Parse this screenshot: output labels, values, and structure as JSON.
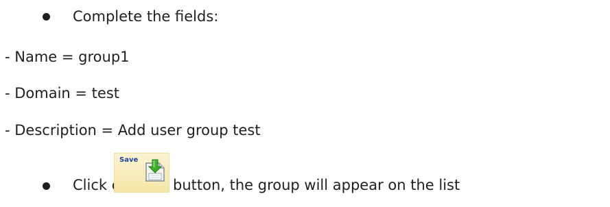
{
  "instructions": {
    "bullet1": "Complete the fields:",
    "name_line": "- Name = group1",
    "domain_line": "- Domain = test",
    "description_line": "- Description = Add user group test",
    "bullet2_before": "Click on",
    "bullet2_after": "button, the group will appear on the list"
  },
  "save_button": {
    "label": "Save",
    "icon": "save-download-icon",
    "bg_color": "#f6e6a8",
    "label_color": "#1d3f9a"
  }
}
